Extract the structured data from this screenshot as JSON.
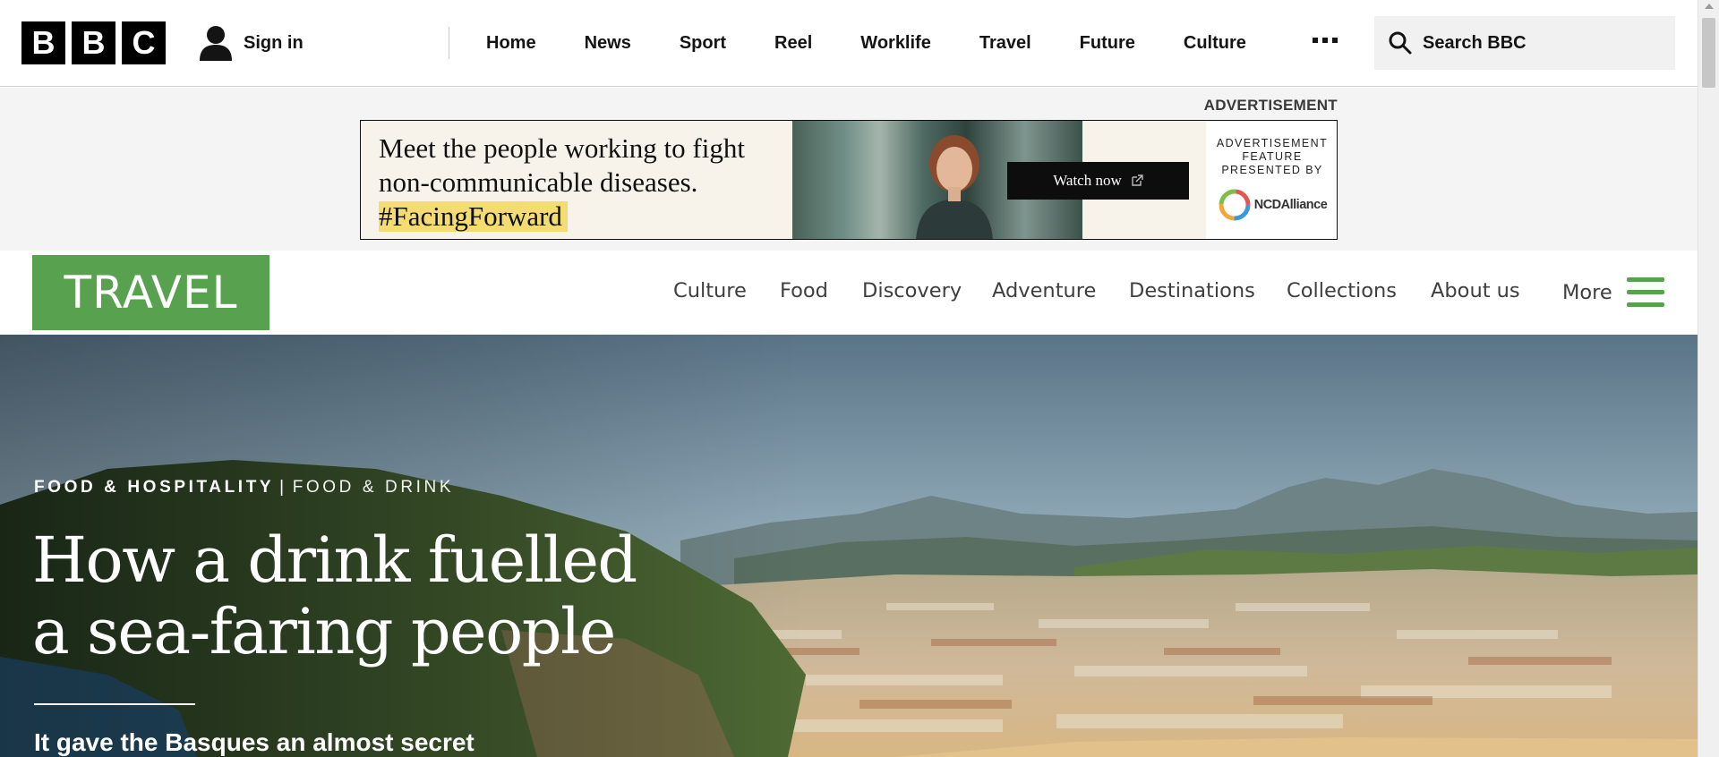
{
  "global_nav": {
    "logo_letters": [
      "B",
      "B",
      "C"
    ],
    "signin_label": "Sign in",
    "signin_icon": "user-icon",
    "links": [
      "Home",
      "News",
      "Sport",
      "Reel",
      "Worklife",
      "Travel",
      "Future",
      "Culture"
    ],
    "more_icon": "ellipsis-icon",
    "search_icon": "search-icon",
    "search_placeholder": "Search BBC"
  },
  "advertisement": {
    "heading": "ADVERTISEMENT",
    "line1": "Meet the people working to fight",
    "line2": "non-communicable diseases.",
    "hashtag": "#FacingForward",
    "cta_label": "Watch now",
    "cta_icon": "external-link-icon",
    "feature_label": "ADVERTISEMENT FEATURE PRESENTED BY",
    "sponsor": "NCDAlliance",
    "highlight_color": "#f3dc72"
  },
  "travel_header": {
    "logo": "TRAVEL",
    "brand_color": "#58a14f",
    "nav": [
      "Culture",
      "Food",
      "Discovery",
      "Adventure",
      "Destinations",
      "Collections",
      "About us"
    ],
    "more_label": "More",
    "menu_icon": "hamburger-menu-icon"
  },
  "hero": {
    "kicker_primary": "FOOD & HOSPITALITY",
    "kicker_separator": "|",
    "kicker_secondary": "FOOD & DRINK",
    "title_line1": "How a drink fuelled",
    "title_line2": "a sea-faring people",
    "standfirst": "It gave the Basques an almost secret"
  }
}
